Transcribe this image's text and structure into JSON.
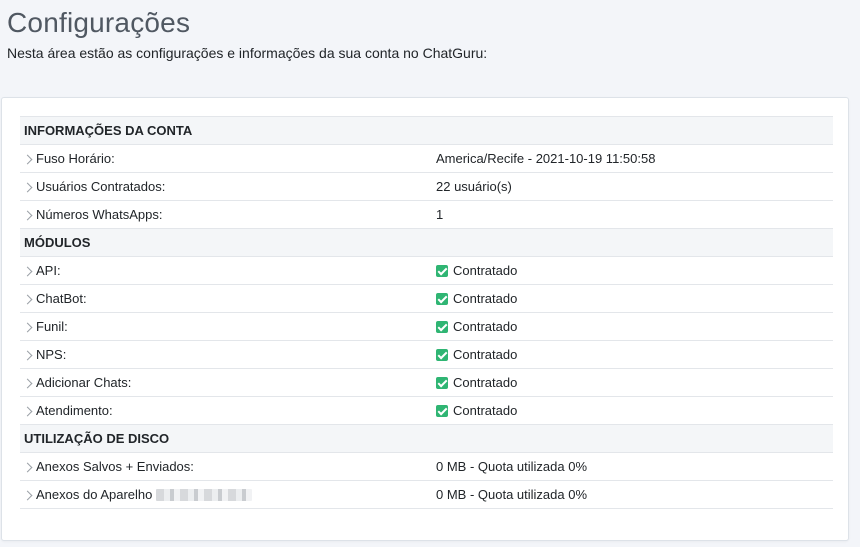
{
  "header": {
    "title": "Configurações",
    "subtitle": "Nesta área estão as configurações e informações da sua conta no ChatGuru:"
  },
  "account": {
    "heading": "INFORMAÇÕES DA CONTA",
    "rows": [
      {
        "label": "Fuso Horário:",
        "value": "America/Recife - 2021-10-19 11:50:58"
      },
      {
        "label": "Usuários Contratados:",
        "value": "22 usuário(s)"
      },
      {
        "label": "Números WhatsApps:",
        "value": "1"
      }
    ]
  },
  "modules": {
    "heading": "MÓDULOS",
    "status_icon": "check-square-icon",
    "status_color": "#2fb573",
    "rows": [
      {
        "label": "API:",
        "value": "Contratado"
      },
      {
        "label": "ChatBot:",
        "value": "Contratado"
      },
      {
        "label": "Funil:",
        "value": "Contratado"
      },
      {
        "label": "NPS:",
        "value": "Contratado"
      },
      {
        "label": "Adicionar Chats:",
        "value": "Contratado"
      },
      {
        "label": "Atendimento:",
        "value": "Contratado"
      }
    ]
  },
  "disk": {
    "heading": "UTILIZAÇÃO DE DISCO",
    "rows": [
      {
        "label": "Anexos Salvos + Enviados:",
        "value": "0 MB - Quota utilizada 0%"
      },
      {
        "label": "Anexos do Aparelho",
        "value": "0 MB - Quota utilizada 0%"
      }
    ]
  }
}
